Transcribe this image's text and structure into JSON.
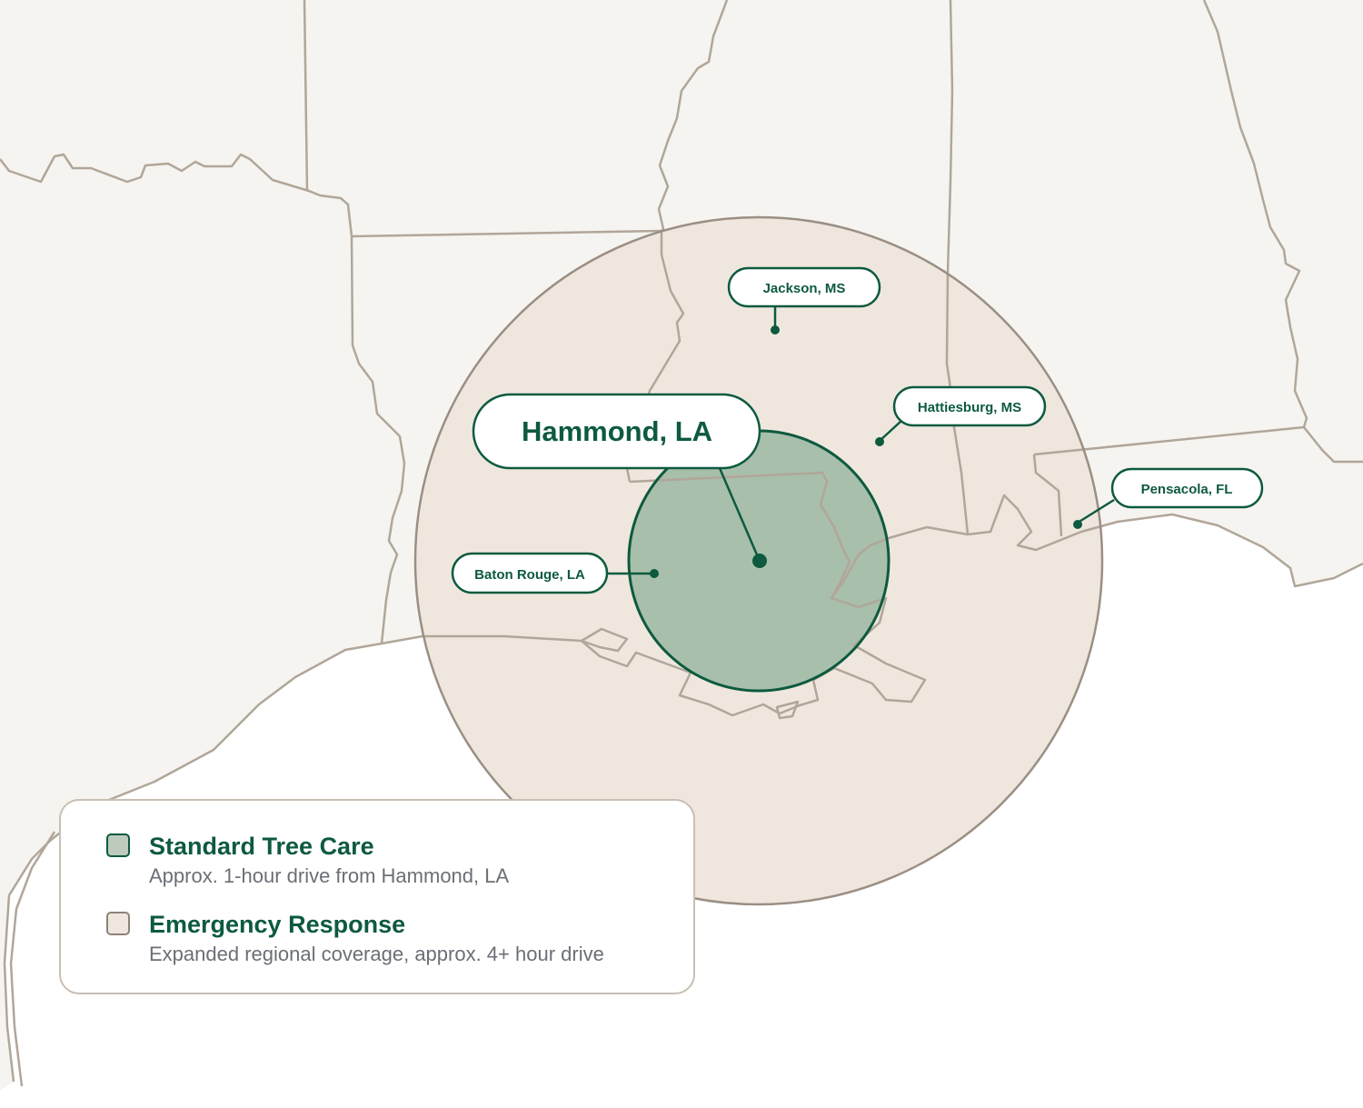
{
  "hub": {
    "label": "Hammond, LA"
  },
  "cities": [
    {
      "id": "baton-rouge",
      "label": "Baton Rouge, LA"
    },
    {
      "id": "jackson",
      "label": "Jackson, MS"
    },
    {
      "id": "hattiesburg",
      "label": "Hattiesburg, MS"
    },
    {
      "id": "pensacola",
      "label": "Pensacola, FL"
    }
  ],
  "legend": {
    "items": [
      {
        "title": "Standard Tree Care",
        "description": "Approx. 1-hour drive from Hammond, LA",
        "color": "#bccbbc"
      },
      {
        "title": "Emergency Response",
        "description": "Expanded regional coverage, approx. 4+ hour drive",
        "color": "#efe7de"
      }
    ]
  },
  "colors": {
    "land": "#f6f4f0",
    "water": "#ffffff",
    "border": "#b1a699",
    "emergency_fill": "#efe7de",
    "standard_fill": "#a7bfab",
    "accent": "#0d5a3f"
  }
}
